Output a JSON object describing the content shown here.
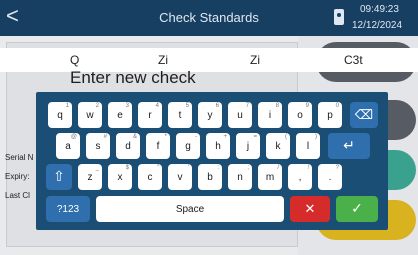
{
  "header": {
    "back_glyph": "<",
    "title": "Check Standards",
    "time": "09:49:23",
    "date": "12/12/2024"
  },
  "form": {
    "row_fragments": [
      "Q",
      "Zi",
      "Zi",
      "C3t"
    ],
    "heading": "Enter new check",
    "side_labels": [
      "Serial N",
      "Expiry:",
      "Last Cl"
    ]
  },
  "keyboard": {
    "row1": [
      {
        "key": "q",
        "hint": "1"
      },
      {
        "key": "w",
        "hint": "2"
      },
      {
        "key": "e",
        "hint": "3"
      },
      {
        "key": "r",
        "hint": "4"
      },
      {
        "key": "t",
        "hint": "5"
      },
      {
        "key": "y",
        "hint": "6"
      },
      {
        "key": "u",
        "hint": "7"
      },
      {
        "key": "i",
        "hint": "8"
      },
      {
        "key": "o",
        "hint": "9"
      },
      {
        "key": "p",
        "hint": "0"
      }
    ],
    "row2": [
      {
        "key": "a",
        "hint": "@"
      },
      {
        "key": "s",
        "hint": "#"
      },
      {
        "key": "d",
        "hint": "&"
      },
      {
        "key": "f",
        "hint": "*"
      },
      {
        "key": "g",
        "hint": "-"
      },
      {
        "key": "h",
        "hint": "+"
      },
      {
        "key": "j",
        "hint": "="
      },
      {
        "key": "k",
        "hint": "("
      },
      {
        "key": "l",
        "hint": ")"
      }
    ],
    "row3": [
      {
        "key": "z",
        "hint": "_"
      },
      {
        "key": "x",
        "hint": "$"
      },
      {
        "key": "c",
        "hint": "\""
      },
      {
        "key": "v",
        "hint": "'"
      },
      {
        "key": "b",
        "hint": ":"
      },
      {
        "key": "n",
        "hint": ";"
      },
      {
        "key": "m",
        "hint": "/"
      },
      {
        "key": ",",
        "hint": "!"
      },
      {
        "key": ".",
        "hint": "?"
      }
    ],
    "symbols_label": "?123",
    "space_label": "Space",
    "backspace_glyph": "⌫",
    "enter_glyph": "↵",
    "shift_glyph": "⇧",
    "cancel_glyph": "✕",
    "ok_glyph": "✓"
  },
  "colors": {
    "header": "#173f61",
    "keyboard": "#1a4e74",
    "accent_blue": "#2f6fae",
    "cancel_red": "#d62b2b",
    "ok_green": "#4ab04a"
  }
}
